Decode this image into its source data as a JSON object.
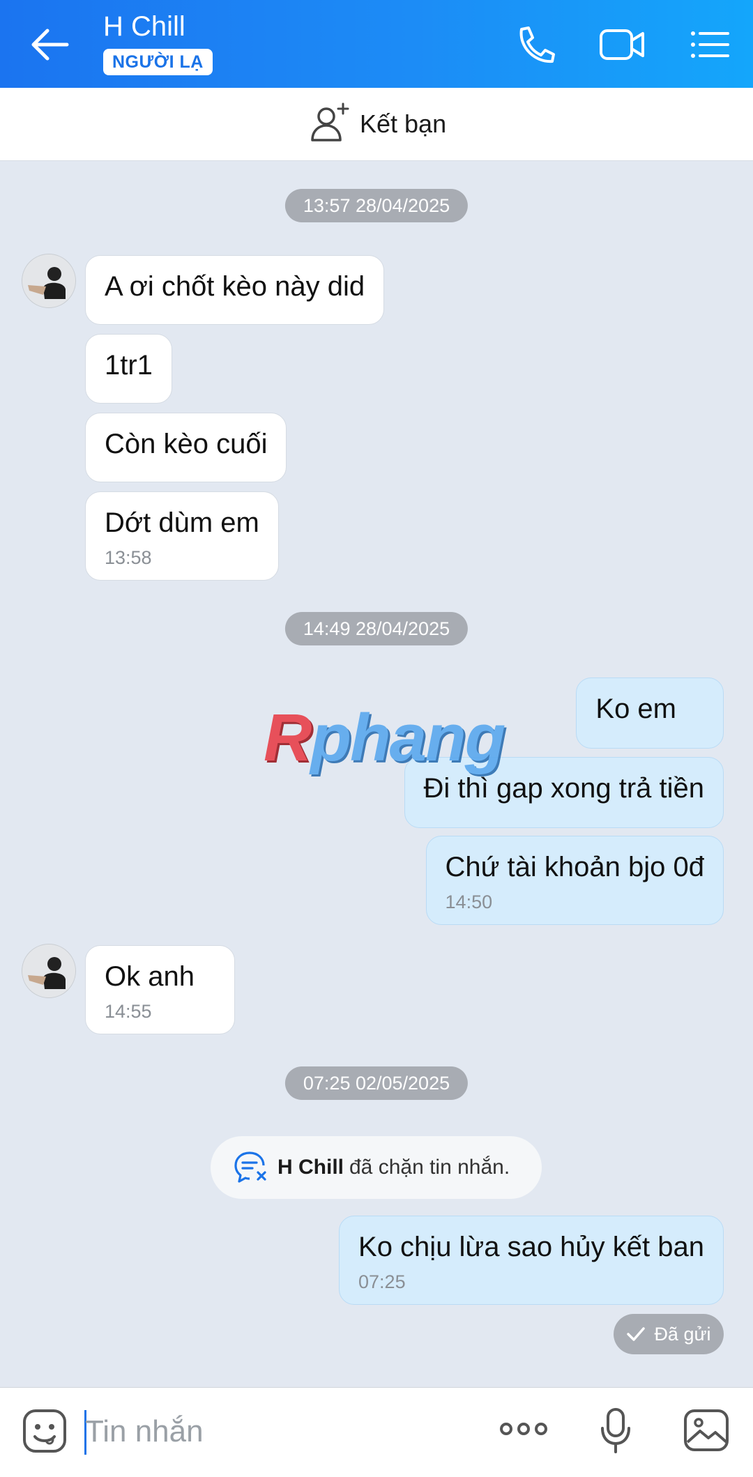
{
  "header": {
    "title": "H Chill",
    "badge": "NGƯỜI LẠ",
    "icons": [
      "back-arrow-icon",
      "phone-icon",
      "video-call-icon",
      "menu-list-icon"
    ]
  },
  "add_friend": {
    "label": "Kết bạn",
    "icon": "add-user-icon"
  },
  "conversation": {
    "time_chips": [
      "13:57 28/04/2025",
      "14:49 28/04/2025",
      "07:25 02/05/2025"
    ],
    "group1": {
      "messages": [
        "A ơi chốt kèo này did",
        "1tr1",
        "Còn kèo cuối",
        "Dớt dùm em"
      ],
      "time": "13:58"
    },
    "group2": {
      "messages": [
        "Ko em",
        "Đi thì gap xong trả tiền",
        "Chứ tài khoản bjo 0đ"
      ],
      "time": "14:50"
    },
    "group3": {
      "message": "Ok anh",
      "time": "14:55"
    },
    "blocked_notice": {
      "name": "H Chill",
      "text": "đã chặn tin nhắn."
    },
    "group4": {
      "message": "Ko chịu lừa sao hủy kết ban",
      "time": "07:25"
    },
    "sent_status": "Đã gửi"
  },
  "watermark": {
    "first": "R",
    "rest": "phang"
  },
  "composer": {
    "placeholder": "Tin nhắn",
    "icons": [
      "emoji-sticker-icon",
      "more-dots-icon",
      "microphone-icon",
      "image-gallery-icon"
    ]
  }
}
